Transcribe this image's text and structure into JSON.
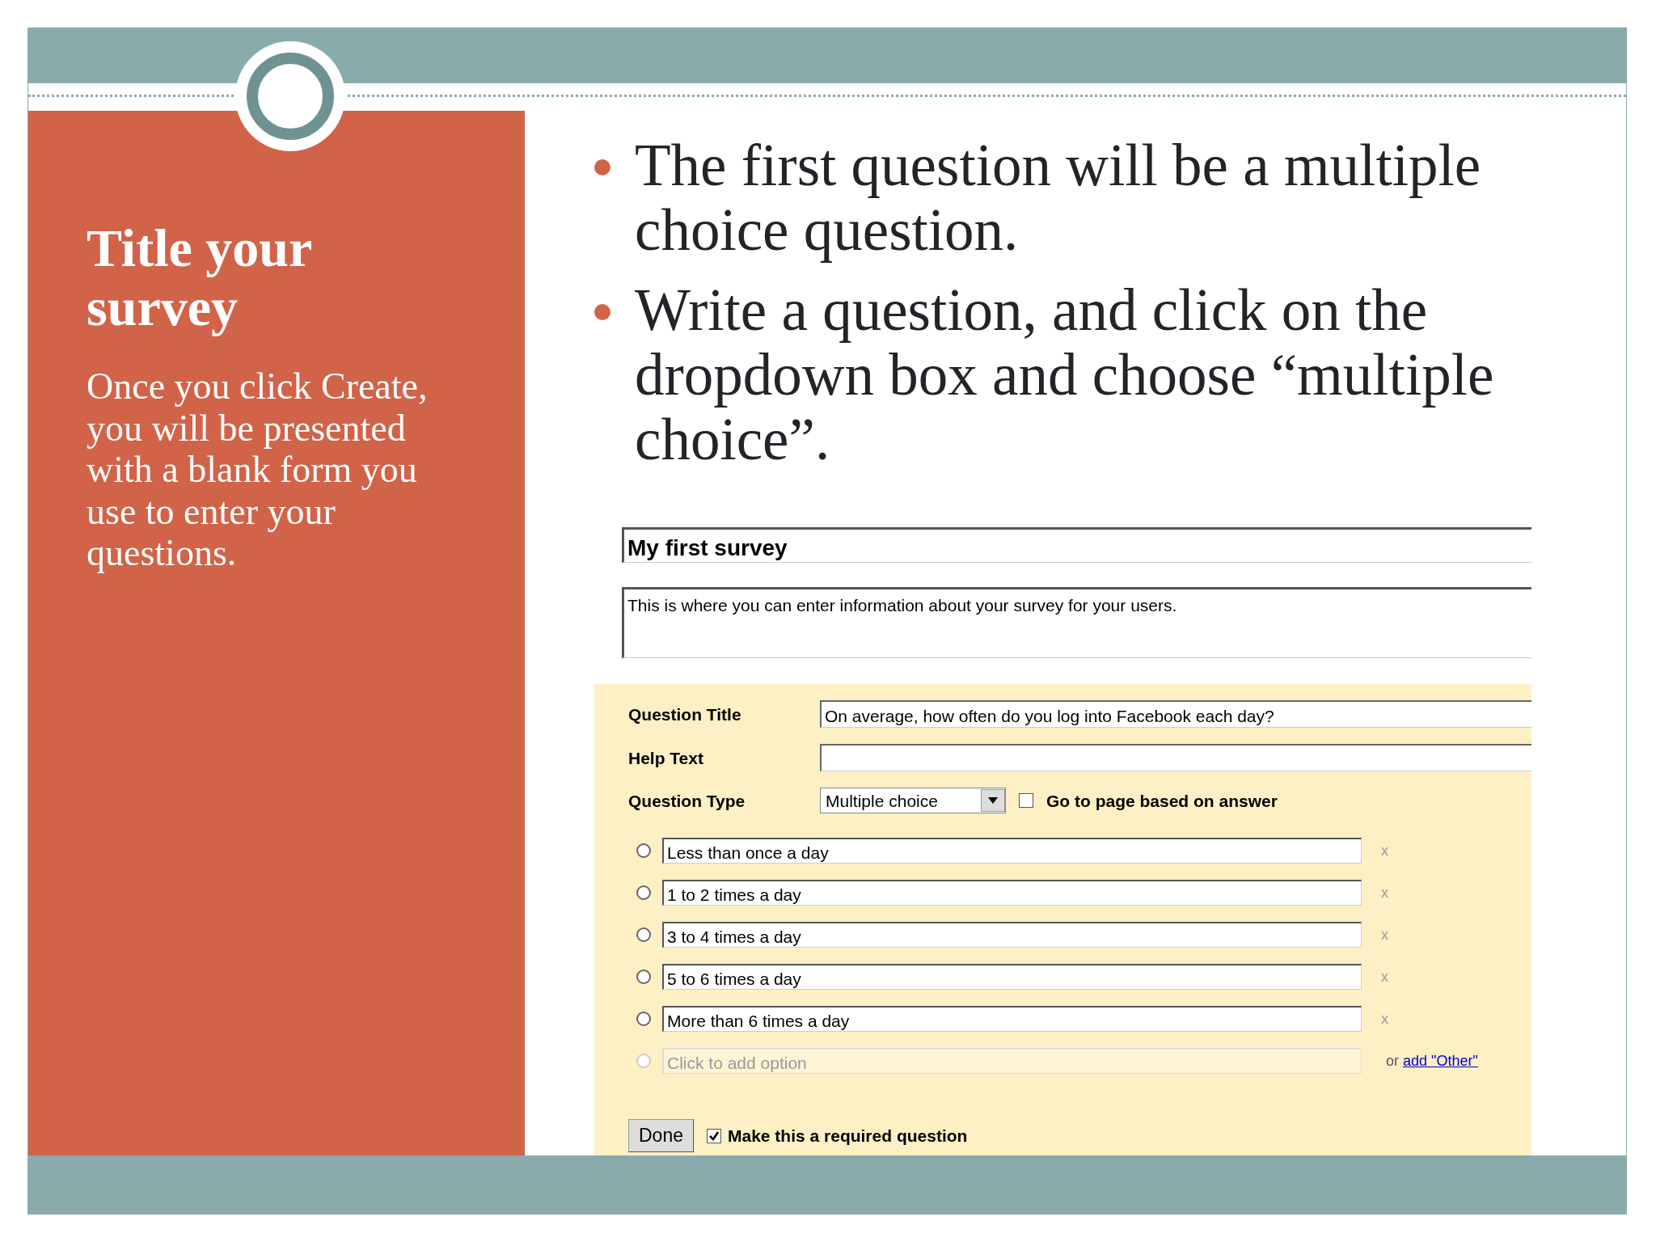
{
  "sidebar": {
    "title": "Title your survey",
    "body": "Once you click Create, you will be presented with a blank form you use to enter your questions."
  },
  "bullets": [
    "The first question will be a multiple choice question.",
    "Write a question, and click on the dropdown box and choose “multiple choice”."
  ],
  "form": {
    "title_value": "My first survey",
    "description_value": "This is where you can enter information about your survey for your users.",
    "fields": [
      {
        "label": "Question Title",
        "value": "On average, how often do you log into Facebook each day?"
      },
      {
        "label": "Help Text"
      }
    ],
    "question_type": {
      "label": "Question Type",
      "value": "Multiple choice"
    },
    "page_nav": {
      "label": "Go to page based on answer",
      "checked": false
    },
    "options": [
      {
        "value": "Less than once a day",
        "selected": false,
        "remove": "x"
      },
      {
        "value": "1 to 2 times a day",
        "selected": false,
        "remove": "x"
      },
      {
        "value": "3 to 4 times a day",
        "selected": false,
        "remove": "x"
      },
      {
        "value": "5 to 6 times a day",
        "selected": false,
        "remove": "x"
      },
      {
        "value": "More than 6 times a day",
        "selected": false,
        "remove": "x"
      }
    ],
    "new_option": {
      "placeholder": "Click to add option",
      "selected": false
    },
    "other": {
      "prefix": "or",
      "link": "add \"Other\""
    },
    "done": "Done",
    "required": {
      "label": "Make this a required question",
      "checked": true
    }
  }
}
